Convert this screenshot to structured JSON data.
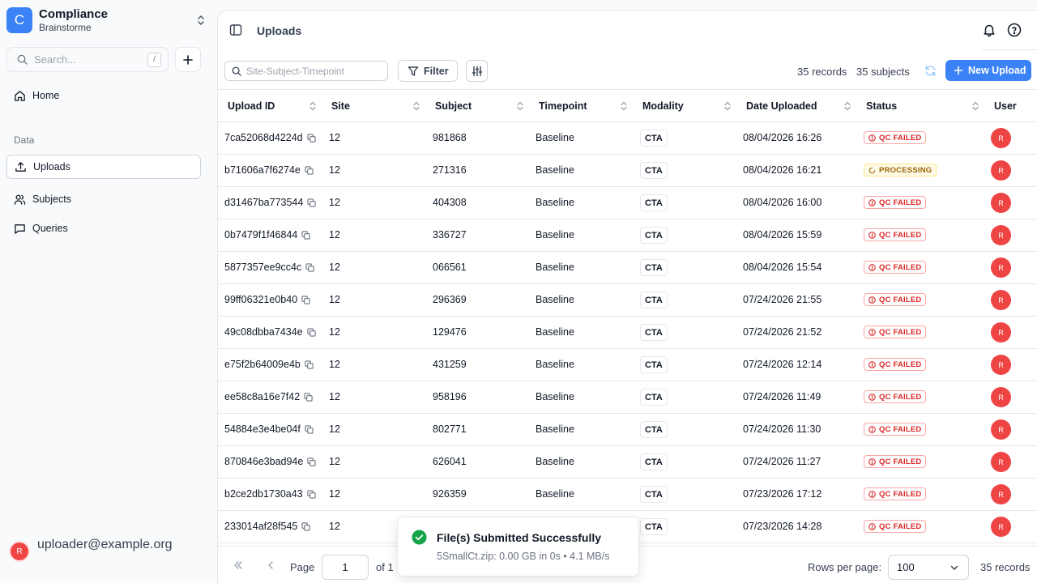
{
  "org": {
    "initial": "C",
    "name": "Compliance",
    "subtitle": "Brainstorme"
  },
  "sidebar": {
    "search_placeholder": "Search...",
    "search_shortcut": "/",
    "home_label": "Home",
    "section_label": "Data",
    "items": [
      {
        "label": "Uploads",
        "icon": "upload-icon",
        "active": true
      },
      {
        "label": "Subjects",
        "icon": "users-icon",
        "active": false
      },
      {
        "label": "Queries",
        "icon": "message-icon",
        "active": false
      }
    ],
    "user": {
      "initial": "R",
      "email": "uploader@example.org"
    }
  },
  "header": {
    "title": "Uploads"
  },
  "toolbar": {
    "search_placeholder": "Site-Subject-Timepoint",
    "filter_label": "Filter",
    "records_text": "35 records",
    "subjects_text": "35 subjects",
    "new_upload_label": "New Upload"
  },
  "table": {
    "columns": [
      "Upload ID",
      "Site",
      "Subject",
      "Timepoint",
      "Modality",
      "Date Uploaded",
      "Status",
      "User"
    ],
    "rows": [
      {
        "id": "7ca52068d4224d",
        "site": "12",
        "subject": "981868",
        "timepoint": "Baseline",
        "modality": "CTA",
        "date": "08/04/2026 16:26",
        "status": "QC FAILED",
        "user": "R"
      },
      {
        "id": "b71606a7f6274e",
        "site": "12",
        "subject": "271316",
        "timepoint": "Baseline",
        "modality": "CTA",
        "date": "08/04/2026 16:21",
        "status": "PROCESSING",
        "user": "R"
      },
      {
        "id": "d31467ba773544",
        "site": "12",
        "subject": "404308",
        "timepoint": "Baseline",
        "modality": "CTA",
        "date": "08/04/2026 16:00",
        "status": "QC FAILED",
        "user": "R"
      },
      {
        "id": "0b7479f1f46844",
        "site": "12",
        "subject": "336727",
        "timepoint": "Baseline",
        "modality": "CTA",
        "date": "08/04/2026 15:59",
        "status": "QC FAILED",
        "user": "R"
      },
      {
        "id": "5877357ee9cc4c",
        "site": "12",
        "subject": "066561",
        "timepoint": "Baseline",
        "modality": "CTA",
        "date": "08/04/2026 15:54",
        "status": "QC FAILED",
        "user": "R"
      },
      {
        "id": "99ff06321e0b40",
        "site": "12",
        "subject": "296369",
        "timepoint": "Baseline",
        "modality": "CTA",
        "date": "07/24/2026 21:55",
        "status": "QC FAILED",
        "user": "R"
      },
      {
        "id": "49c08dbba7434e",
        "site": "12",
        "subject": "129476",
        "timepoint": "Baseline",
        "modality": "CTA",
        "date": "07/24/2026 21:52",
        "status": "QC FAILED",
        "user": "R"
      },
      {
        "id": "e75f2b64009e4b",
        "site": "12",
        "subject": "431259",
        "timepoint": "Baseline",
        "modality": "CTA",
        "date": "07/24/2026 12:14",
        "status": "QC FAILED",
        "user": "R"
      },
      {
        "id": "ee58c8a16e7f42",
        "site": "12",
        "subject": "958196",
        "timepoint": "Baseline",
        "modality": "CTA",
        "date": "07/24/2026 11:49",
        "status": "QC FAILED",
        "user": "R"
      },
      {
        "id": "54884e3e4be04f",
        "site": "12",
        "subject": "802771",
        "timepoint": "Baseline",
        "modality": "CTA",
        "date": "07/24/2026 11:30",
        "status": "QC FAILED",
        "user": "R"
      },
      {
        "id": "870846e3bad94e",
        "site": "12",
        "subject": "626041",
        "timepoint": "Baseline",
        "modality": "CTA",
        "date": "07/24/2026 11:27",
        "status": "QC FAILED",
        "user": "R"
      },
      {
        "id": "b2ce2db1730a43",
        "site": "12",
        "subject": "926359",
        "timepoint": "Baseline",
        "modality": "CTA",
        "date": "07/23/2026 17:12",
        "status": "QC FAILED",
        "user": "R"
      },
      {
        "id": "233014af28f545",
        "site": "12",
        "subject": "",
        "timepoint": "",
        "modality": "CTA",
        "date": "07/23/2026 14:28",
        "status": "QC FAILED",
        "user": "R"
      }
    ]
  },
  "pagination": {
    "page_label": "Page",
    "page_value": "1",
    "of_text": "of 1",
    "rows_per_page_label": "Rows per page:",
    "rows_per_page_value": "100",
    "records_text": "35 records"
  },
  "toast": {
    "title": "File(s) Submitted Successfully",
    "description": "5SmallCt.zip: 0.00 GB in 0s • 4.1 MB/s"
  },
  "colors": {
    "accent": "#3b82f6",
    "danger": "#dc2626",
    "success": "#16a34a",
    "warning": "#a16207"
  }
}
